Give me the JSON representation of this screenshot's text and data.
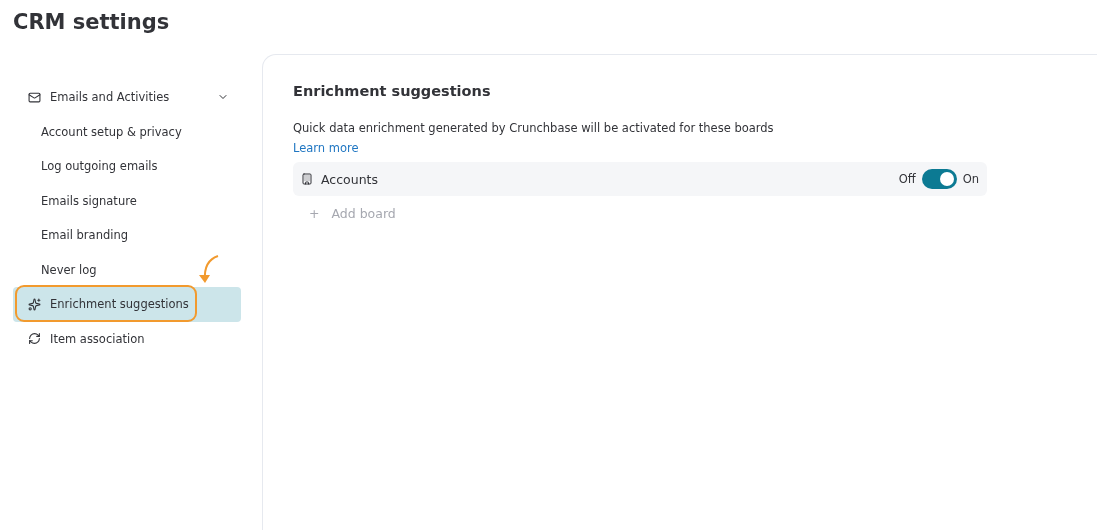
{
  "page": {
    "title": "CRM settings"
  },
  "sidebar": {
    "items": [
      {
        "label": "Emails and Activities",
        "expanded": true,
        "selected": false,
        "children": [
          {
            "label": "Account setup & privacy",
            "selected": false
          },
          {
            "label": "Log outgoing emails",
            "selected": false
          },
          {
            "label": "Emails signature",
            "selected": false
          },
          {
            "label": "Email branding",
            "selected": false
          },
          {
            "label": "Never log",
            "selected": false
          }
        ]
      },
      {
        "label": "Enrichment suggestions",
        "selected": true
      },
      {
        "label": "Item association",
        "selected": false
      }
    ]
  },
  "content": {
    "heading": "Enrichment suggestions",
    "description": "Quick data enrichment generated by Crunchbase will be activated for these boards",
    "link": "Learn more",
    "boards": [
      {
        "name": "Accounts",
        "off_label": "Off",
        "on_label": "On",
        "on": true
      }
    ],
    "add_board": {
      "icon": "+",
      "label": "Add board"
    }
  }
}
